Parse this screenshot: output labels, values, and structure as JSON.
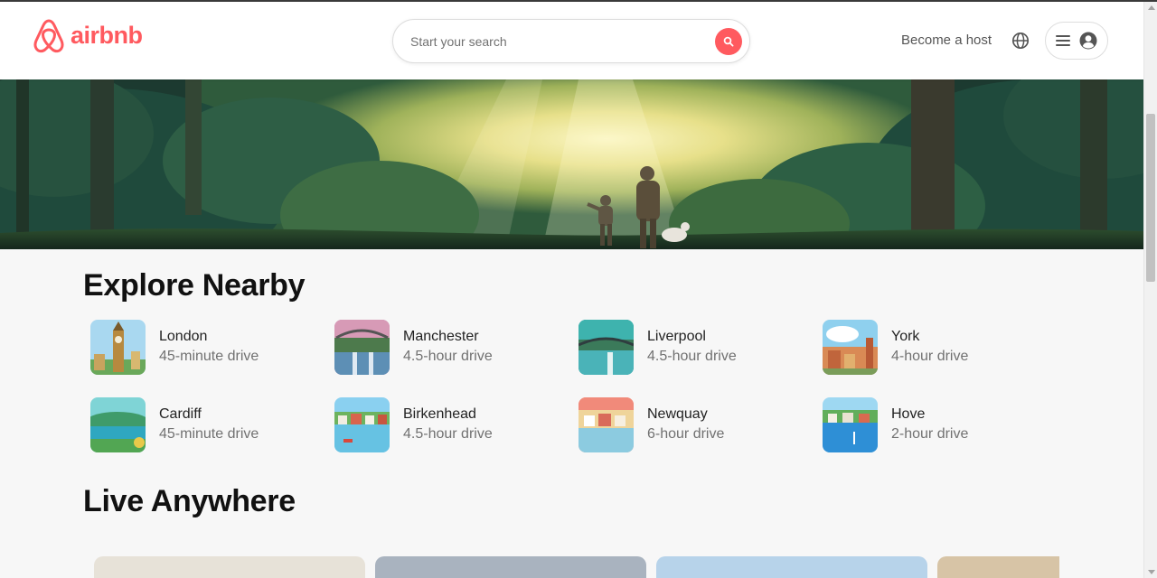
{
  "header": {
    "logo_text": "airbnb",
    "search_placeholder": "Start your search",
    "become_host_label": "Become a host",
    "brand_color": "#ff5a5f"
  },
  "explore": {
    "title": "Explore Nearby",
    "places": [
      {
        "name": "London",
        "distance": "45-minute drive"
      },
      {
        "name": "Manchester",
        "distance": "4.5-hour drive"
      },
      {
        "name": "Liverpool",
        "distance": "4.5-hour drive"
      },
      {
        "name": "York",
        "distance": "4-hour drive"
      },
      {
        "name": "Cardiff",
        "distance": "45-minute drive"
      },
      {
        "name": "Birkenhead",
        "distance": "4.5-hour drive"
      },
      {
        "name": "Newquay",
        "distance": "6-hour drive"
      },
      {
        "name": "Hove",
        "distance": "2-hour drive"
      }
    ]
  },
  "live": {
    "title": "Live Anywhere"
  },
  "icons": [
    "airbnb-logo-icon",
    "search-icon",
    "globe-icon",
    "hamburger-menu-icon",
    "user-account-icon"
  ]
}
